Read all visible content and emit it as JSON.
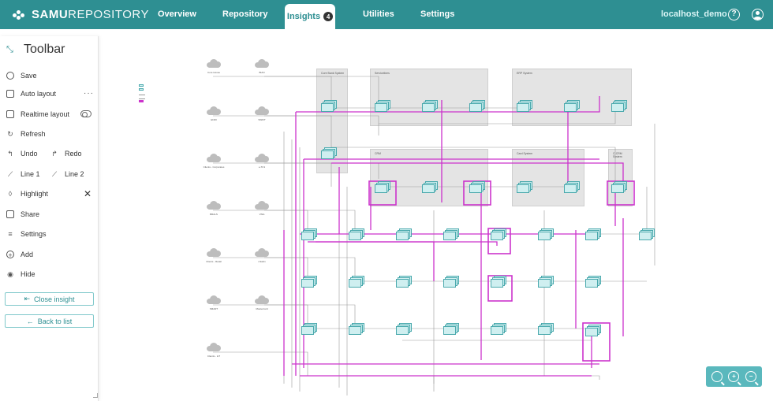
{
  "app": {
    "logo_bold": "SAMU",
    "logo_regular": "REPOSITORY"
  },
  "nav": {
    "items": [
      "Overview",
      "Repository",
      "Insights",
      "Utilities",
      "Settings"
    ],
    "active": "Insights",
    "active_badge": "4",
    "user": "localhost_demo",
    "help_glyph": "?"
  },
  "toolbar": {
    "title": "Toolbar",
    "save": "Save",
    "auto_layout": "Auto layout",
    "auto_layout_more": "···",
    "realtime_layout": "Realtime layout",
    "refresh": "Refresh",
    "undo": "Undo",
    "redo": "Redo",
    "line1": "Line 1",
    "line2": "Line 2",
    "highlight": "Highlight",
    "highlight_clear": "✕",
    "share": "Share",
    "settings": "Settings",
    "add": "Add",
    "hide": "Hide",
    "close_insight": "Close insight",
    "back_to_list": "Back to list"
  },
  "diagram": {
    "groups": [
      "Core Bank System",
      "Servicelines",
      "ERP System",
      "CRM",
      "Card System",
      "C-CRM System"
    ],
    "clouds": [
      "Core House",
      "BIAN",
      "ENRI",
      "SWIFT",
      "Clients - Corporates",
      "e-TLS",
      "BRALS",
      "VISA",
      "Clients - Retail",
      "i-Nalim",
      "SMART",
      "Mastercard",
      "Clients - IoT"
    ]
  },
  "colors": {
    "brand": "#2e8f92",
    "highlight": "#cc33cc",
    "group_bg": "#e4e4e4",
    "node_fill": "#cfeff0",
    "node_stroke": "#4aa9ad"
  },
  "icons": {
    "collapse": "collapse-arrows-icon",
    "save": "save-icon",
    "auto_layout": "grid-icon",
    "realtime": "toggle-icon",
    "refresh": "refresh-icon",
    "undo": "undo-icon",
    "redo": "redo-icon",
    "line": "line-icon",
    "highlight": "highlight-icon",
    "share": "share-icon",
    "settings": "sliders-icon",
    "add": "plus-circle-icon",
    "hide": "eye-off-icon",
    "zoom_fit": "zoom-fit-icon",
    "zoom_in": "zoom-in-icon",
    "zoom_out": "zoom-out-icon"
  }
}
